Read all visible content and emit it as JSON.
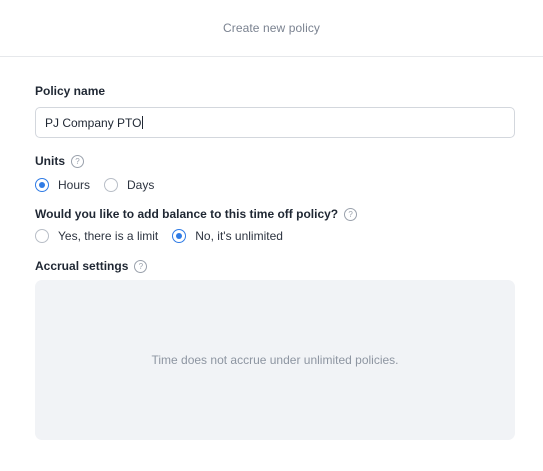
{
  "header": {
    "title": "Create new policy"
  },
  "form": {
    "policy_name": {
      "label": "Policy name",
      "value": "PJ Company PTO"
    },
    "units": {
      "label": "Units",
      "options": [
        {
          "label": "Hours",
          "selected": true
        },
        {
          "label": "Days",
          "selected": false
        }
      ]
    },
    "balance": {
      "label": "Would you like to add balance to this time off policy?",
      "options": [
        {
          "label": "Yes, there is a limit",
          "selected": false
        },
        {
          "label": "No, it's unlimited",
          "selected": true
        }
      ]
    },
    "accrual": {
      "label": "Accrual settings",
      "message": "Time does not accrue under unlimited policies."
    },
    "help_icon_glyph": "?"
  },
  "colors": {
    "accent": "#2f7be5",
    "panel_bg": "#f1f3f6"
  }
}
